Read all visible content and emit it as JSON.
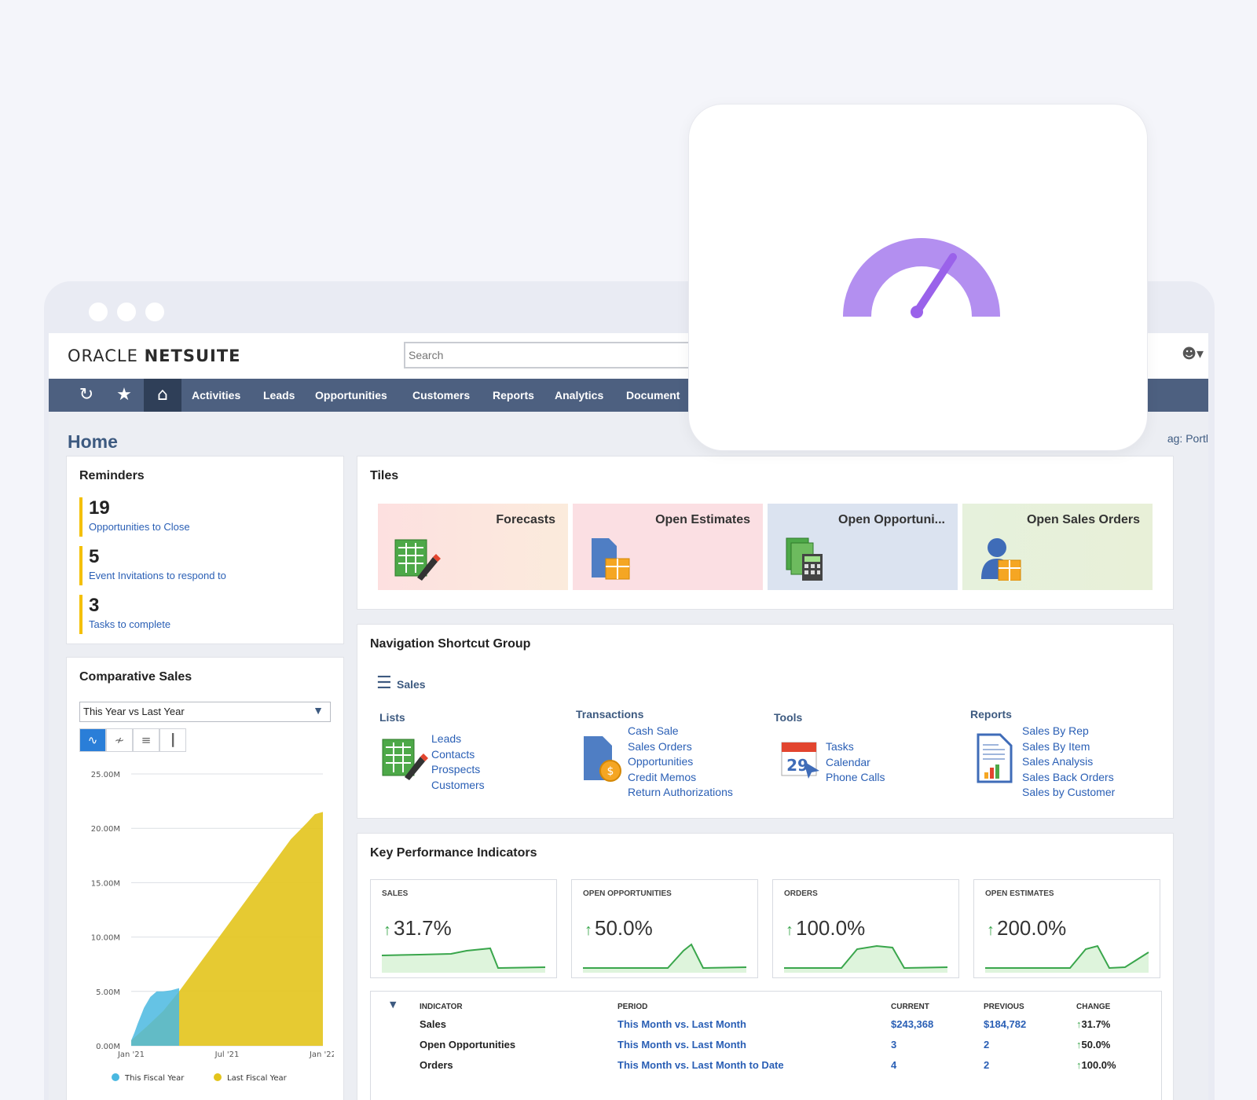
{
  "app": {
    "logo_brand": "ORACLE",
    "logo_product": "NETSUITE",
    "search_placeholder": "Search",
    "nav": [
      "Activities",
      "Leads",
      "Opportunities",
      "Customers",
      "Reports",
      "Analytics",
      "Document"
    ],
    "page_title": "Home",
    "layout_link": "ag: Portl"
  },
  "reminders": {
    "title": "Reminders",
    "items": [
      {
        "count": "19",
        "label": "Opportunities to Close"
      },
      {
        "count": "5",
        "label": "Event Invitations to respond to"
      },
      {
        "count": "3",
        "label": "Tasks to complete"
      }
    ]
  },
  "comparative_sales": {
    "title": "Comparative Sales",
    "select_value": "This Year vs Last Year"
  },
  "chart_data": {
    "type": "area",
    "title": "",
    "x_ticks": [
      "Jan '21",
      "Jul '21",
      "Jan '22"
    ],
    "y_ticks": [
      "25.00M",
      "20.00M",
      "15.00M",
      "10.00M",
      "5.00M",
      "0.00M"
    ],
    "ylim": [
      0,
      25
    ],
    "y_unit": "M",
    "legend_position": "bottom",
    "series": [
      {
        "name": "This Fiscal Year",
        "color": "#4ab8e0",
        "x": [
          0,
          0.2,
          0.4,
          0.8,
          1.2,
          1.6,
          2.0,
          2.5,
          3.0
        ],
        "values": [
          0.5,
          1.2,
          2.0,
          3.5,
          4.5,
          5.0,
          5.0,
          5.1,
          5.3
        ]
      },
      {
        "name": "Last Fiscal Year",
        "color": "#e3c41c",
        "x": [
          0,
          1,
          2,
          3,
          4,
          5,
          6,
          7,
          8,
          9,
          10,
          11,
          11.5,
          12
        ],
        "values": [
          0.5,
          1.8,
          3.2,
          5,
          7,
          9,
          11,
          13,
          15,
          17,
          19,
          20.5,
          21.3,
          21.5
        ]
      }
    ]
  },
  "tiles": {
    "title": "Tiles",
    "items": [
      {
        "label": "Forecasts",
        "bg": "#fbe6dd",
        "icon": "forecast-sheet-icon"
      },
      {
        "label": "Open Estimates",
        "bg": "#fbdfe3",
        "icon": "estimate-document-icon"
      },
      {
        "label": "Open Opportuni...",
        "bg": "#dbe3f0",
        "icon": "opportunity-calculator-icon"
      },
      {
        "label": "Open Sales Orders",
        "bg": "#e6f1dc",
        "icon": "sales-order-person-icon"
      }
    ]
  },
  "shortcuts": {
    "title": "Navigation Shortcut Group",
    "group": "Sales",
    "lists": {
      "head": "Lists",
      "links": [
        "Leads",
        "Contacts",
        "Prospects",
        "Customers"
      ]
    },
    "transactions": {
      "head": "Transactions",
      "links": [
        "Cash Sale",
        "Sales Orders",
        "Opportunities",
        "Credit Memos",
        "Return Authorizations"
      ]
    },
    "tools": {
      "head": "Tools",
      "links": [
        "Tasks",
        "Calendar",
        "Phone Calls"
      ]
    },
    "reports": {
      "head": "Reports",
      "links": [
        "Sales By Rep",
        "Sales By Item",
        "Sales Analysis",
        "Sales Back Orders",
        "Sales by Customer"
      ]
    }
  },
  "kpi": {
    "title": "Key Performance Indicators",
    "cards": [
      {
        "label": "SALES",
        "value": "31.7%"
      },
      {
        "label": "OPEN OPPORTUNITIES",
        "value": "50.0%"
      },
      {
        "label": "ORDERS",
        "value": "100.0%"
      },
      {
        "label": "OPEN ESTIMATES",
        "value": "200.0%"
      }
    ],
    "table_headers": [
      "INDICATOR",
      "PERIOD",
      "CURRENT",
      "PREVIOUS",
      "CHANGE"
    ],
    "rows": [
      {
        "indicator": "Sales",
        "period": "This Month vs. Last Month",
        "current": "$243,368",
        "previous": "$184,782",
        "change": "31.7%"
      },
      {
        "indicator": "Open Opportunities",
        "period": "This Month vs. Last Month",
        "current": "3",
        "previous": "2",
        "change": "50.0%"
      },
      {
        "indicator": "Orders",
        "period": "This Month vs. Last Month to Date",
        "current": "4",
        "previous": "2",
        "change": "100.0%"
      }
    ]
  },
  "overlay": {
    "icon": "speedometer-gauge-icon",
    "accent": "#b18cf0",
    "needle": "#9a62ea"
  }
}
